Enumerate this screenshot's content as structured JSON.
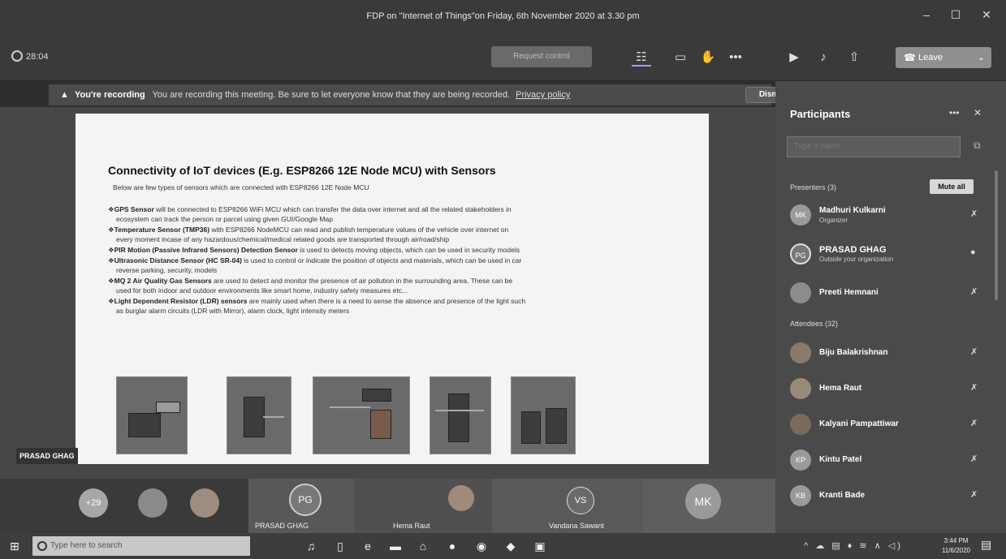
{
  "window": {
    "title": "FDP on \"Internet of Things\"on Friday, 6th November 2020 at 3.30 pm",
    "minimize": "–",
    "maximize": "☐",
    "close": "✕"
  },
  "toolbar": {
    "timer": "28:04",
    "request_control": "Request control",
    "leave_label": "Leave",
    "icons": [
      "participants-icon",
      "chat-icon",
      "raise-hand-icon",
      "more-icon",
      "camera-off-icon",
      "mic-off-icon",
      "share-icon"
    ]
  },
  "recording_banner": {
    "warning_glyph": "▲",
    "heading": "You're recording",
    "message": "You are recording this meeting. Be sure to let everyone know that they are being recorded.",
    "link": "Privacy policy",
    "dismiss": "Dismiss"
  },
  "slide": {
    "title": "Connectivity of IoT devices (E.g. ESP8266 12E Node MCU) with Sensors",
    "subtitle": "Below are few types of sensors which are connected with ESP8266 12E Node MCU",
    "bullets": [
      {
        "head": "GPS Sensor",
        "text": " will be connected to ESP8266 WiFi MCU which can transfer the data over internet and all the related stakeholders in",
        "cont": "ecosystem can track the person or parcel using given GUI/Google Map"
      },
      {
        "head": "Temperature Sensor (TMP36)",
        "text": " with ESP8266 NodeMCU can read and publish temperature values of the vehicle over internet on",
        "cont": "every moment incase of any hazardous/chemical/medical related goods are transported through air/road/ship"
      },
      {
        "head": "PIR Motion (Passive Infrared Sensors) Detection Sensor",
        "text": " is used to detects moving objects, which can be used in security models",
        "cont": ""
      },
      {
        "head": "Ultrasonic Distance Sensor (HC SR-04)",
        "text": " is used to control or indicate the position of objects and materials, which can be used in car",
        "cont": "reverse parking, security,  models"
      },
      {
        "head": "MQ 2 Air Quality Gas Sensors",
        "text": " are used to detect and monitor the presence of air pollution in the surrounding area. These can be",
        "cont": "used for both indoor and outdoor environments like smart home, industry safety measures etc..."
      },
      {
        "head": "Light Dependent Resistor (LDR) sensors",
        "text": " are mainly used when there is a need to sense the absence and presence of the light such",
        "cont": "as burglar alarm circuits (LDR with Mirror), alarm clock, light intensity meters"
      }
    ],
    "bullet_glyph": "❖"
  },
  "presenter_tag": "PRASAD GHAG",
  "strip": {
    "overflow_count": "+29",
    "tiles": [
      {
        "initials": "PG",
        "name": "PRASAD GHAG"
      },
      {
        "initials": "",
        "name": "Hema Raut"
      },
      {
        "initials": "VS",
        "name": "Vandana Sawant"
      },
      {
        "initials": "MK",
        "name": ""
      }
    ]
  },
  "panel": {
    "title": "Participants",
    "more": "•••",
    "close": "✕",
    "search_placeholder": "Type a name",
    "presenters_label": "Presenters (3)",
    "mute_all": "Mute all",
    "presenters": [
      {
        "initials": "MK",
        "name": "Madhuri Kulkarni",
        "sub": "Organizer"
      },
      {
        "initials": "PG",
        "name": "PRASAD GHAG",
        "sub": "Outside your organization"
      },
      {
        "initials": "",
        "name": "Preeti Hemnani",
        "sub": ""
      }
    ],
    "attendees_label": "Attendees (32)",
    "attendees": [
      {
        "initials": "",
        "name": "Biju Balakrishnan"
      },
      {
        "initials": "",
        "name": "Hema Raut"
      },
      {
        "initials": "",
        "name": "Kalyani Pampattiwar"
      },
      {
        "initials": "KP",
        "name": "Kintu Patel"
      },
      {
        "initials": "KB",
        "name": "Kranti Bade"
      }
    ]
  },
  "taskbar": {
    "search_placeholder": "Type here to search",
    "time": "3:44 PM",
    "date": "11/6/2020"
  }
}
